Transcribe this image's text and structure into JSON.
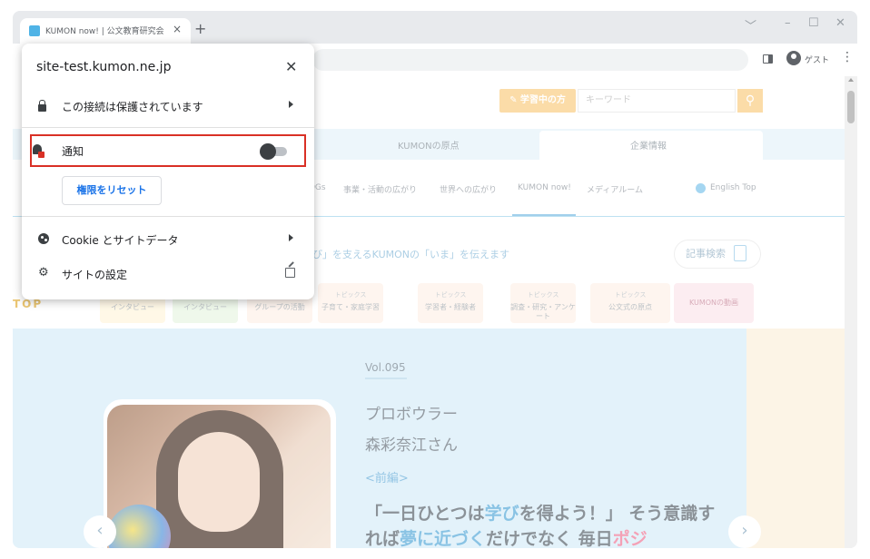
{
  "browser": {
    "tab_title": "KUMON now! | 公文教育研究会",
    "tab_close": "×",
    "new_tab": "+",
    "window_controls": [
      "﹀",
      "–",
      "☐",
      "✕"
    ],
    "profile_label": "ゲスト",
    "menu": "⋮"
  },
  "site_info": {
    "host": "site-test.kumon.ne.jp",
    "close": "✕",
    "connection_label": "この接続は保護されています",
    "notification_label": "通知",
    "notification_enabled": false,
    "reset_label": "権限をリセット",
    "cookie_label": "Cookie とサイトデータ",
    "settings_label": "サイトの設定"
  },
  "page": {
    "learning_button": "✎ 学習中の方",
    "keyword_placeholder": "キーワード",
    "search_icon": "search-icon",
    "nav_top": [
      "KUMONの原点",
      "企業情報"
    ],
    "subnav": [
      "DGs",
      "事業・活動の広がり",
      "世界への広がり",
      "KUMON now!",
      "メディアルーム",
      "English Top"
    ],
    "tagline": "び」を支えるKUMONの「いま」を伝えます",
    "article_search": "記事検索",
    "categories": [
      {
        "kicker": "ス",
        "title": "グループの活動"
      },
      {
        "kicker": "トピックス",
        "title": "子育て・家庭学習"
      },
      {
        "kicker": "トピックス",
        "title": "学習者・経験者"
      },
      {
        "kicker": "トピックス",
        "title": "調査・研究・アンケート"
      },
      {
        "kicker": "トピックス",
        "title": "公文式の原点"
      }
    ],
    "video_category": "KUMONの動画",
    "left_peek_labels": [
      "TOP",
      "インタビュー",
      "インタビュー"
    ],
    "hero": {
      "vol": "Vol.095",
      "profession": "プロボウラー",
      "person": "森彩奈江さん",
      "part": "<前編>",
      "quote_1": "「一日ひとつは",
      "quote_hl1": "学び",
      "quote_2": "を得よう！」 そう意識すれば",
      "quote_hl2": "夢に近づく",
      "quote_3": "だけでなく 毎日",
      "quote_hl3": "ポジ",
      "prev": "‹",
      "next": "›"
    }
  }
}
